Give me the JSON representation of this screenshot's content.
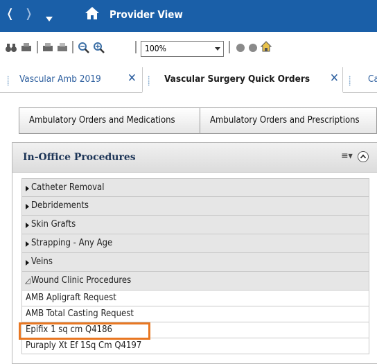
{
  "window": {
    "title": "Provider View"
  },
  "toolbar": {
    "zoom_value": "100%"
  },
  "tabs": [
    {
      "label": "Vascular Amb 2019",
      "active": false
    },
    {
      "label": "Vascular Surgery Quick Orders",
      "active": true
    },
    {
      "label": "Ca",
      "active": false
    }
  ],
  "order_buttons": [
    {
      "label": "Ambulatory Orders and Medications"
    },
    {
      "label": "Ambulatory Orders and Prescriptions"
    }
  ],
  "panel": {
    "title": "In-Office Procedures",
    "folders": [
      {
        "label": "Catheter Removal",
        "expanded": false
      },
      {
        "label": "Debridements",
        "expanded": false
      },
      {
        "label": "Skin Grafts",
        "expanded": false
      },
      {
        "label": "Strapping - Any Age",
        "expanded": false
      },
      {
        "label": "Veins",
        "expanded": false
      },
      {
        "label": "Wound Clinic Procedures",
        "expanded": true
      }
    ],
    "items": [
      {
        "label": "AMB Apligraft Request"
      },
      {
        "label": "AMB Total Casting Request"
      },
      {
        "label": "Epifix 1 sq cm Q4186"
      },
      {
        "label": "Puraply Xt Ef 1Sq Cm Q4197"
      }
    ]
  },
  "colors": {
    "title_bar": "#1a5fa8",
    "highlight": "#e87722",
    "tab_text": "#2c5e9e"
  }
}
